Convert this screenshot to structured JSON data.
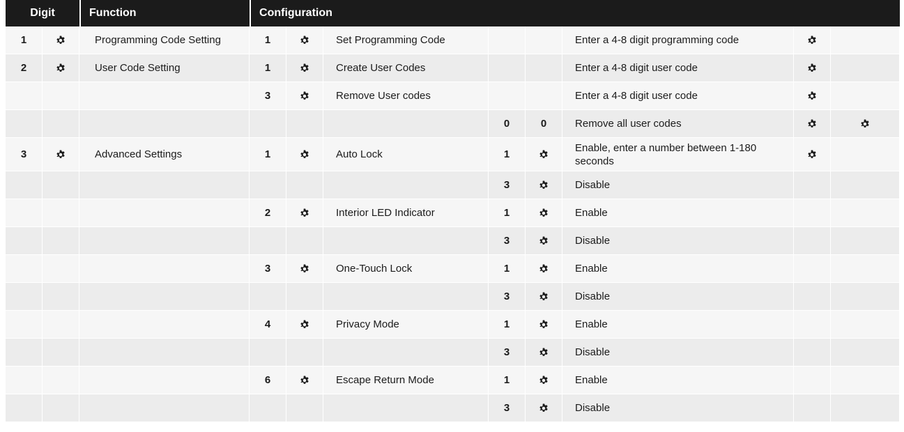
{
  "header": {
    "digit": "Digit",
    "function": "Function",
    "configuration": "Configuration"
  },
  "icon": "gear-icon",
  "rows": [
    {
      "d1": "1",
      "g1": true,
      "func": "Programming Code Setting",
      "d2": "1",
      "g2": true,
      "conf": "Set Programming Code",
      "d3": "",
      "g3": false,
      "desc": "Enter a 4-8 digit programming code",
      "g4": true,
      "g5": false
    },
    {
      "d1": "2",
      "g1": true,
      "func": "User Code Setting",
      "d2": "1",
      "g2": true,
      "conf": "Create User Codes",
      "d3": "",
      "g3": false,
      "desc": "Enter a 4-8 digit user code",
      "g4": true,
      "g5": false
    },
    {
      "d1": "",
      "g1": false,
      "func": "",
      "d2": "3",
      "g2": true,
      "conf": "Remove User codes",
      "d3": "",
      "g3": false,
      "desc": "Enter a 4-8 digit user code",
      "g4": true,
      "g5": false
    },
    {
      "d1": "",
      "g1": false,
      "func": "",
      "d2": "",
      "g2": false,
      "conf": "",
      "d3": "0",
      "d3b": "0",
      "g3": false,
      "desc": "Remove all user codes",
      "g4": true,
      "g5": true
    },
    {
      "d1": "3",
      "g1": true,
      "func": "Advanced Settings",
      "d2": "1",
      "g2": true,
      "conf": "Auto Lock",
      "d3": "1",
      "g3": true,
      "desc": "Enable, enter a number between 1-180 seconds",
      "g4": true,
      "g5": false,
      "tall": true
    },
    {
      "d1": "",
      "g1": false,
      "func": "",
      "d2": "",
      "g2": false,
      "conf": "",
      "d3": "3",
      "g3": true,
      "desc": "Disable",
      "g4": false,
      "g5": false
    },
    {
      "d1": "",
      "g1": false,
      "func": "",
      "d2": "2",
      "g2": true,
      "conf": "Interior LED Indicator",
      "d3": "1",
      "g3": true,
      "desc": "Enable",
      "g4": false,
      "g5": false
    },
    {
      "d1": "",
      "g1": false,
      "func": "",
      "d2": "",
      "g2": false,
      "conf": "",
      "d3": "3",
      "g3": true,
      "desc": "Disable",
      "g4": false,
      "g5": false
    },
    {
      "d1": "",
      "g1": false,
      "func": "",
      "d2": "3",
      "g2": true,
      "conf": "One-Touch Lock",
      "d3": "1",
      "g3": true,
      "desc": "Enable",
      "g4": false,
      "g5": false
    },
    {
      "d1": "",
      "g1": false,
      "func": "",
      "d2": "",
      "g2": false,
      "conf": "",
      "d3": "3",
      "g3": true,
      "desc": "Disable",
      "g4": false,
      "g5": false
    },
    {
      "d1": "",
      "g1": false,
      "func": "",
      "d2": "4",
      "g2": true,
      "conf": "Privacy Mode",
      "d3": "1",
      "g3": true,
      "desc": "Enable",
      "g4": false,
      "g5": false
    },
    {
      "d1": "",
      "g1": false,
      "func": "",
      "d2": "",
      "g2": false,
      "conf": "",
      "d3": "3",
      "g3": true,
      "desc": "Disable",
      "g4": false,
      "g5": false
    },
    {
      "d1": "",
      "g1": false,
      "func": "",
      "d2": "6",
      "g2": true,
      "conf": "Escape Return Mode",
      "d3": "1",
      "g3": true,
      "desc": "Enable",
      "g4": false,
      "g5": false
    },
    {
      "d1": "",
      "g1": false,
      "func": "",
      "d2": "",
      "g2": false,
      "conf": "",
      "d3": "3",
      "g3": true,
      "desc": "Disable",
      "g4": false,
      "g5": false
    }
  ]
}
